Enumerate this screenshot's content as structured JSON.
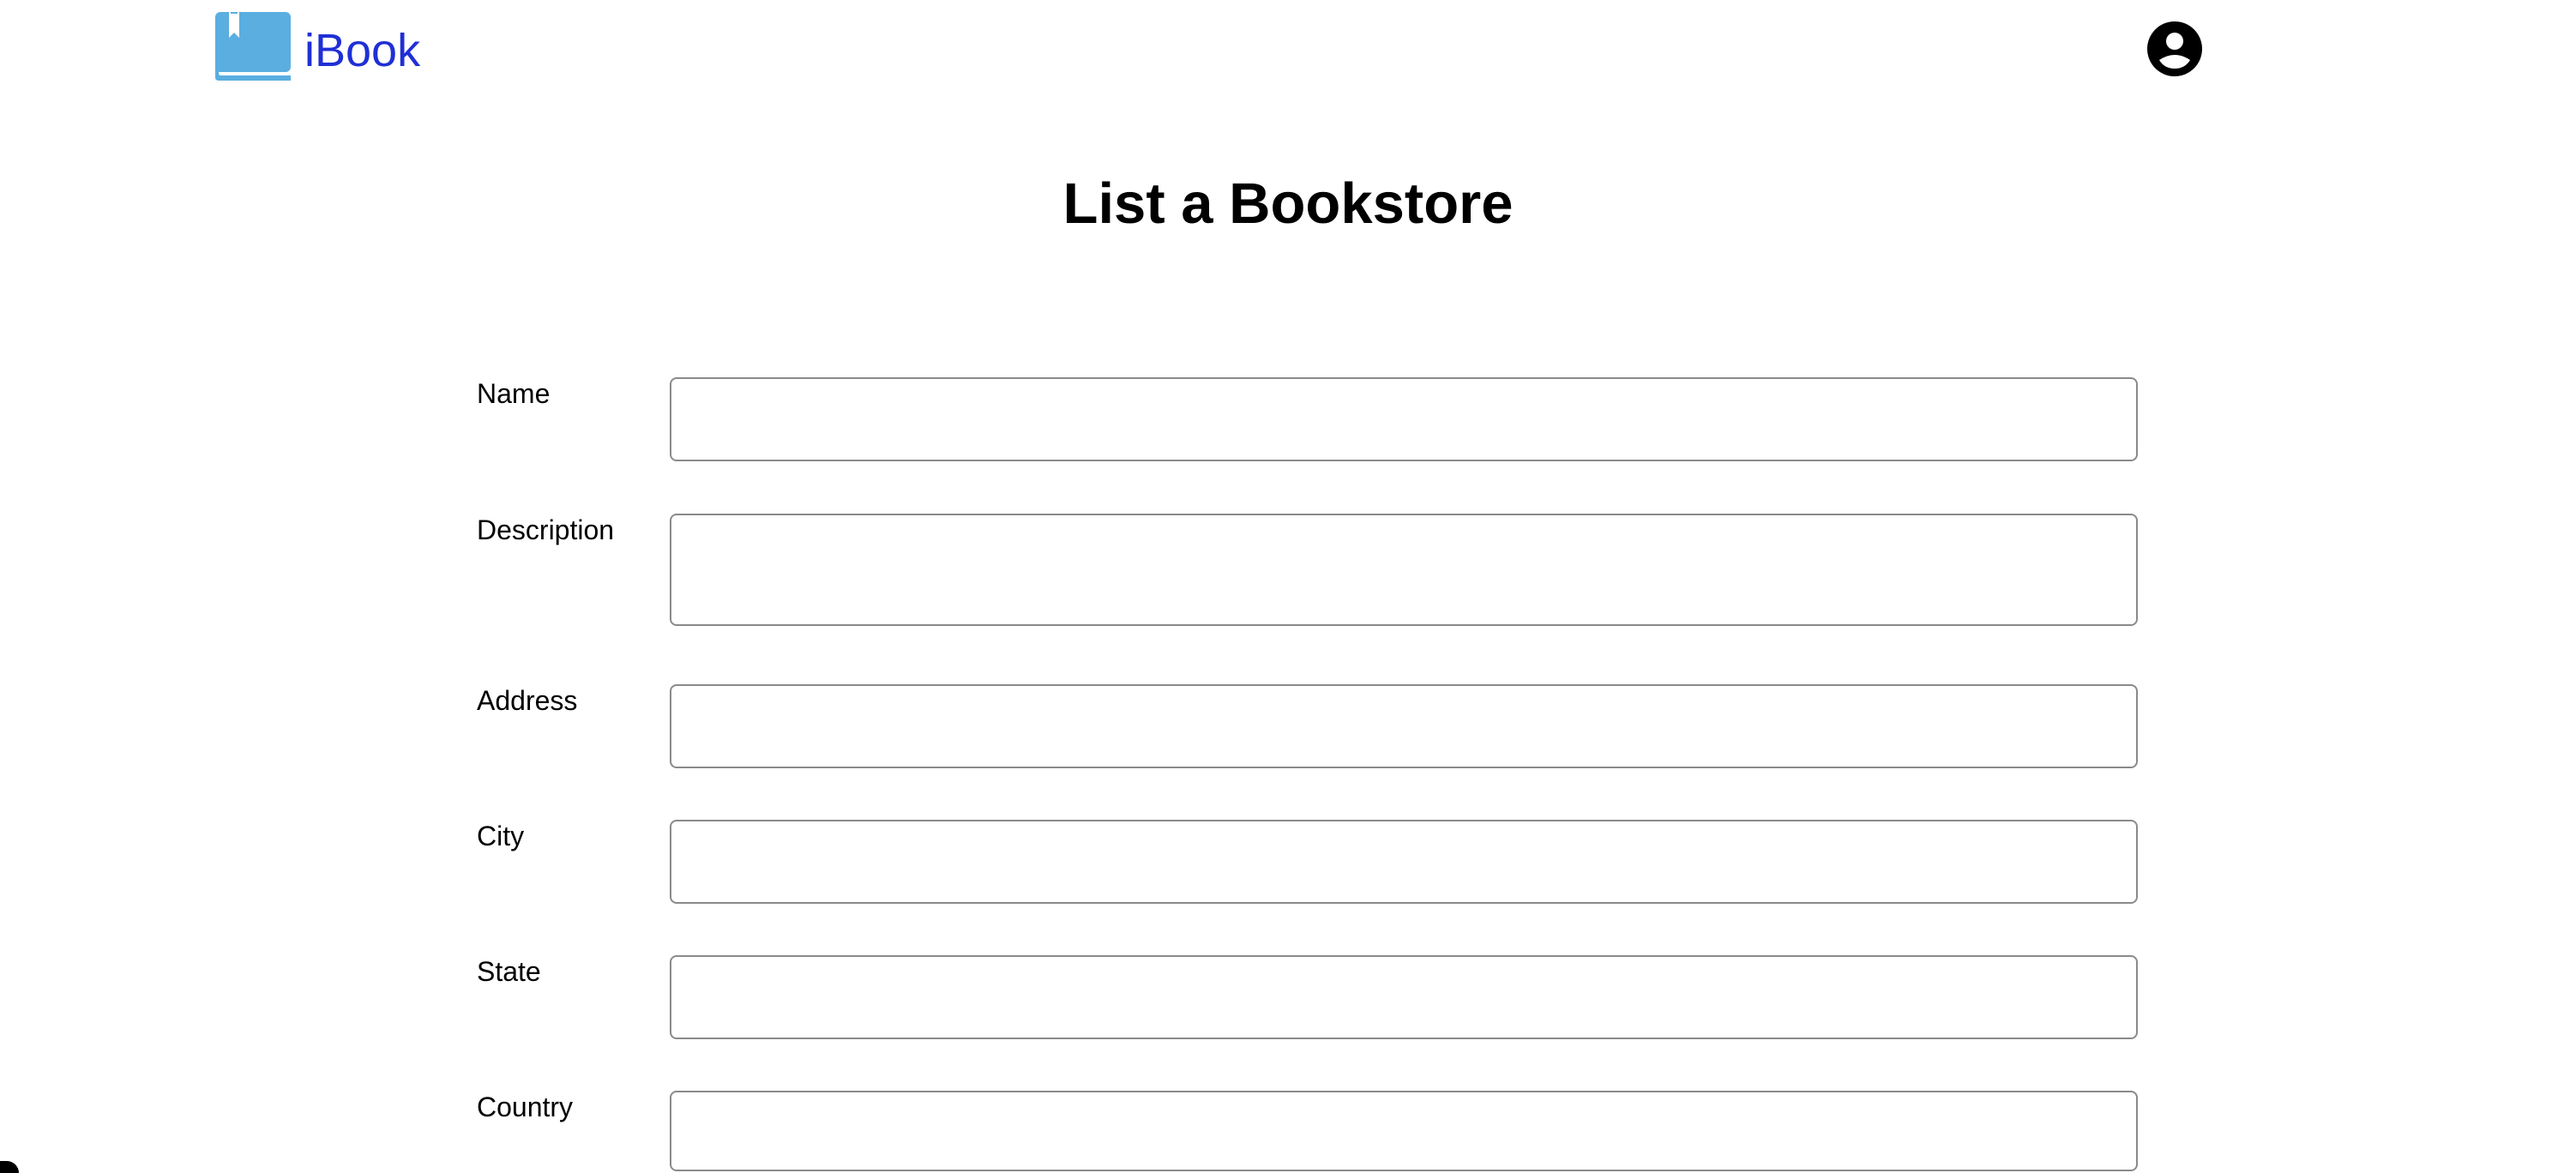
{
  "header": {
    "brand_name": "iBook",
    "brand_color": "#1f2fd6",
    "logo_icon": "book-icon",
    "logo_icon_color": "#5aaee0",
    "account_icon": "account-circle-icon"
  },
  "page": {
    "title": "List a Bookstore"
  },
  "form": {
    "fields": [
      {
        "label": "Name",
        "value": "",
        "placeholder": ""
      },
      {
        "label": "Description",
        "value": "",
        "placeholder": ""
      },
      {
        "label": "Address",
        "value": "",
        "placeholder": ""
      },
      {
        "label": "City",
        "value": "",
        "placeholder": ""
      },
      {
        "label": "State",
        "value": "",
        "placeholder": ""
      },
      {
        "label": "Country",
        "value": "",
        "placeholder": ""
      }
    ]
  }
}
